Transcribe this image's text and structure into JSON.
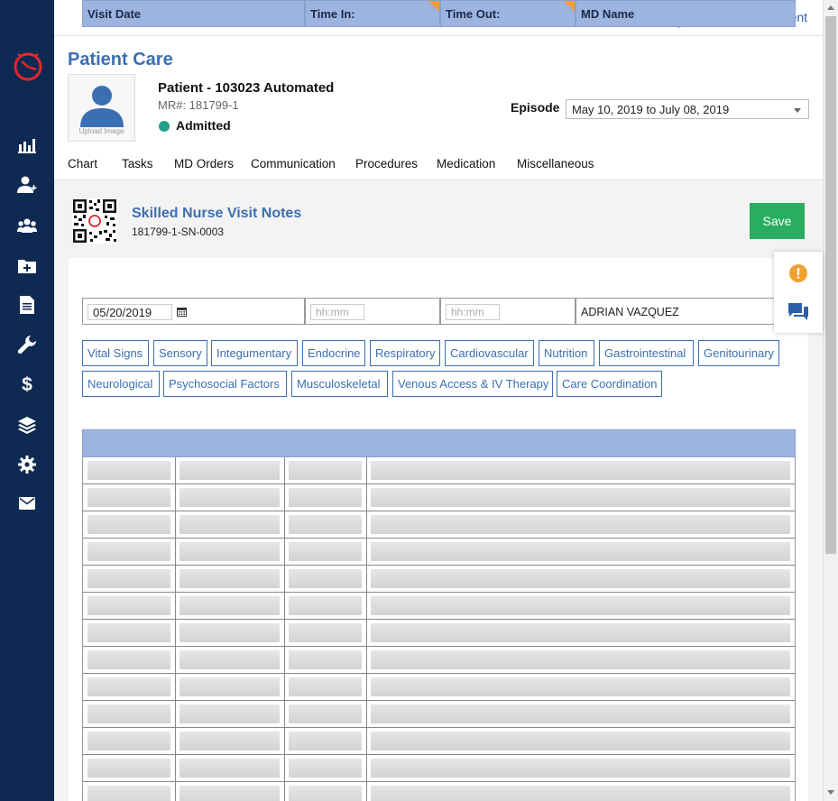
{
  "topbar": {
    "user_name": "Super Agent",
    "icons": [
      "mail-icon",
      "bell-icon",
      "user-icon"
    ]
  },
  "sidebar": {
    "icons": [
      "bar-chart-icon",
      "user-add-icon",
      "users-group-icon",
      "folder-plus-icon",
      "document-icon",
      "wrench-icon",
      "dollar-icon",
      "layers-icon",
      "gear-icon",
      "mail-icon"
    ]
  },
  "header": {
    "page_title": "Patient Care",
    "avatar_label": "Upload Image",
    "patient_name": "Patient - 103023 Automated",
    "mr": "MR#: 181799-1",
    "status": "Admitted",
    "episode_label": "Episode",
    "episode_value": "May 10, 2019 to July 08, 2019"
  },
  "nav": {
    "tabs": [
      "Chart",
      "Tasks",
      "MD Orders",
      "Communication",
      "Procedures",
      "Medication",
      "Miscellaneous"
    ]
  },
  "note": {
    "title": "Skilled Nurse Visit Notes",
    "id": "181799-1-SN-0003",
    "save_label": "Save"
  },
  "visit": {
    "headers": [
      "Visit Date",
      "Time In:",
      "Time Out:",
      "MD Name"
    ],
    "visit_date": "05/20/2019",
    "time_in_placeholder": "hh:mm",
    "time_out_placeholder": "hh:mm",
    "md_name": "ADRIAN VAZQUEZ"
  },
  "sections": {
    "row1": [
      "Vital Signs",
      "Sensory",
      "Integumentary",
      "Endocrine",
      "Respiratory",
      "Cardiovascular",
      "Nutrition",
      "Gastrointestinal",
      "Genitourinary"
    ],
    "row2": [
      "Neurological",
      "Psychosocial Factors",
      "Musculoskeletal",
      "Venous Access & IV Therapy",
      "Care Coordination"
    ]
  },
  "colors": {
    "sidebar": "#0e2a52",
    "accent": "#3b6fb3",
    "save": "#27ae60",
    "status": "#22a08a",
    "header_row": "#9db3e0",
    "alert": "#f0a030"
  }
}
